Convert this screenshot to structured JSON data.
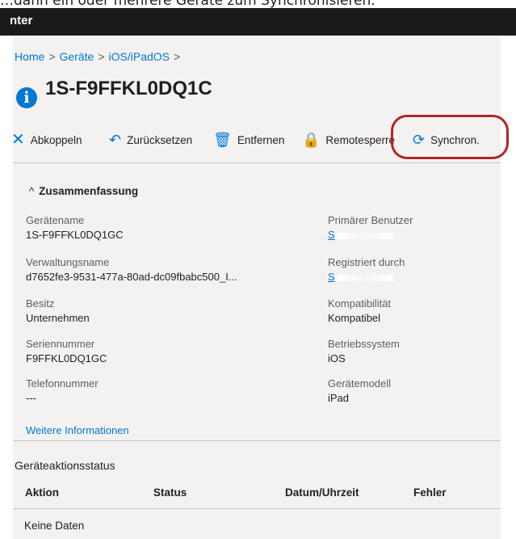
{
  "caption": "…dann ein oder mehrere Geräte zum Synchronisieren.",
  "topbar": {
    "title": "nter"
  },
  "breadcrumb": [
    {
      "label": "Home"
    },
    {
      "label": "Geräte"
    },
    {
      "label": "iOS/iPadOS"
    }
  ],
  "breadcrumb_separator": ">",
  "device": {
    "icon": "i",
    "title": "1S-F9FFKL0DQ1C"
  },
  "toolbar": {
    "disconnect": {
      "label": "Abkoppeln",
      "icon": "close-x-icon",
      "glyph": "✕"
    },
    "reset": {
      "label": "Zurücksetzen",
      "icon": "undo-icon",
      "glyph": "↶"
    },
    "remove": {
      "label": "Entfernen",
      "icon": "trash-icon",
      "glyph": "🗑"
    },
    "remotelock": {
      "label": "Remotesperre",
      "icon": "lock-icon",
      "glyph": "🔒"
    },
    "sync": {
      "label": "Synchron.",
      "icon": "sync-icon",
      "glyph": "⟳"
    }
  },
  "summary": {
    "heading": "Zusammenfassung",
    "chevron": "^",
    "left": [
      {
        "label": "Gerätename",
        "value": "1S-F9FFKL0DQ1GC"
      },
      {
        "label": "Verwaltungsname",
        "value": "d7652fe3-9531-477a-80ad-dc09fbabc500_I..."
      },
      {
        "label": "Besitz",
        "value": "Unternehmen"
      },
      {
        "label": "Seriennummer",
        "value": "F9FFKL0DQ1GC"
      },
      {
        "label": "Telefonnummer",
        "value": "---"
      }
    ],
    "right": [
      {
        "label": "Primärer Benutzer",
        "value": "S"
      },
      {
        "label": "Registriert durch",
        "value": "S"
      },
      {
        "label": "Kompatibilität",
        "value": "Kompatibel"
      },
      {
        "label": "Betriebssystem",
        "value": "iOS"
      },
      {
        "label": "Gerätemodell",
        "value": "iPad"
      }
    ],
    "more_link": "Weitere Informationen"
  },
  "actions": {
    "title": "Geräteaktionsstatus",
    "columns": [
      "Aktion",
      "Status",
      "Datum/Uhrzeit",
      "Fehler"
    ],
    "empty_text": "Keine Daten"
  },
  "colors": {
    "accent": "#0078d4",
    "highlight": "#b22525",
    "topbar": "#1b1a19"
  }
}
